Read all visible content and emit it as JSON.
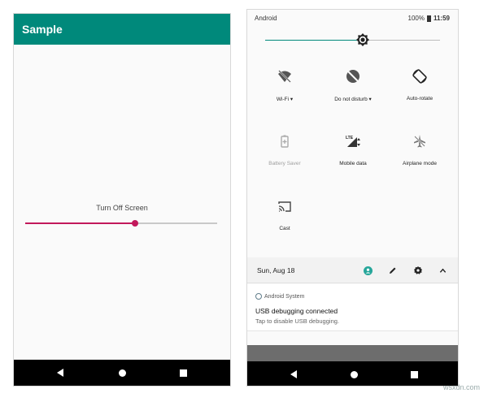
{
  "left_phone": {
    "app_title": "Sample",
    "slider": {
      "label": "Turn Off Screen",
      "value_fraction": 0.57,
      "accent": "#c2185b"
    },
    "appbar_color": "#00897b",
    "nav": {
      "back_icon": "back-icon",
      "home_icon": "home-icon",
      "recents_icon": "recents-icon"
    }
  },
  "right_phone": {
    "status_bar": {
      "carrier": "Android",
      "battery": "100%",
      "time": "11:59"
    },
    "brightness": {
      "value_fraction": 0.56,
      "accent": "#00897b",
      "icon": "brightness-icon"
    },
    "tiles": [
      {
        "label": "Wi-Fi",
        "icon": "wifi-off-icon",
        "has_dropdown": true
      },
      {
        "label": "Do not disturb",
        "icon": "do-not-disturb-icon",
        "has_dropdown": true
      },
      {
        "label": "Auto-rotate",
        "icon": "auto-rotate-icon",
        "has_dropdown": false
      },
      {
        "label": "Battery Saver",
        "icon": "battery-saver-icon",
        "disabled": true
      },
      {
        "label": "Mobile data",
        "icon": "mobile-data-icon",
        "has_dropdown": false
      },
      {
        "label": "Airplane mode",
        "icon": "airplane-mode-icon",
        "has_dropdown": false
      },
      {
        "label": "Cast",
        "icon": "cast-icon",
        "has_dropdown": false
      }
    ],
    "footer": {
      "date": "Sun, Aug 18"
    },
    "notification": {
      "app_name": "Android System",
      "title": "USB debugging connected",
      "text": "Tap to disable USB debugging."
    }
  },
  "watermark": "wsxdn.com"
}
